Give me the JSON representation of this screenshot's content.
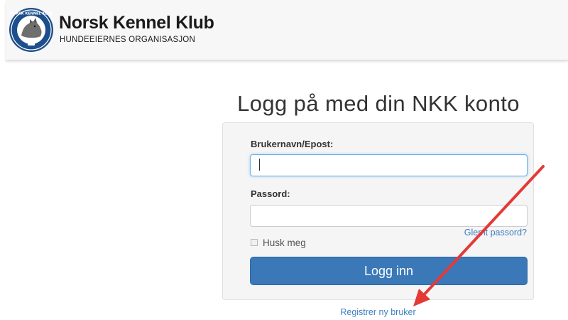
{
  "header": {
    "brand_name": "Norsk Kennel Klub",
    "brand_subtitle": "HUNDEEIERNES ORGANISASJON",
    "logo_icon": "nkk-dog-emblem-icon"
  },
  "login": {
    "title": "Logg på med din NKK konto",
    "username_label": "Brukernavn/Epost:",
    "username_value": "",
    "password_label": "Passord:",
    "password_value": "",
    "forgot_password_label": "Glemt passord?",
    "remember_me_label": "Husk meg",
    "remember_me_checked": false,
    "login_button_label": "Logg inn",
    "register_link_label": "Registrer ny bruker"
  },
  "annotation": {
    "arrow_icon": "red-arrow-icon",
    "arrow_color": "#e53935"
  },
  "colors": {
    "primary_button": "#3a78b8",
    "link": "#3d7fc1",
    "panel_background": "#f5f5f5"
  }
}
